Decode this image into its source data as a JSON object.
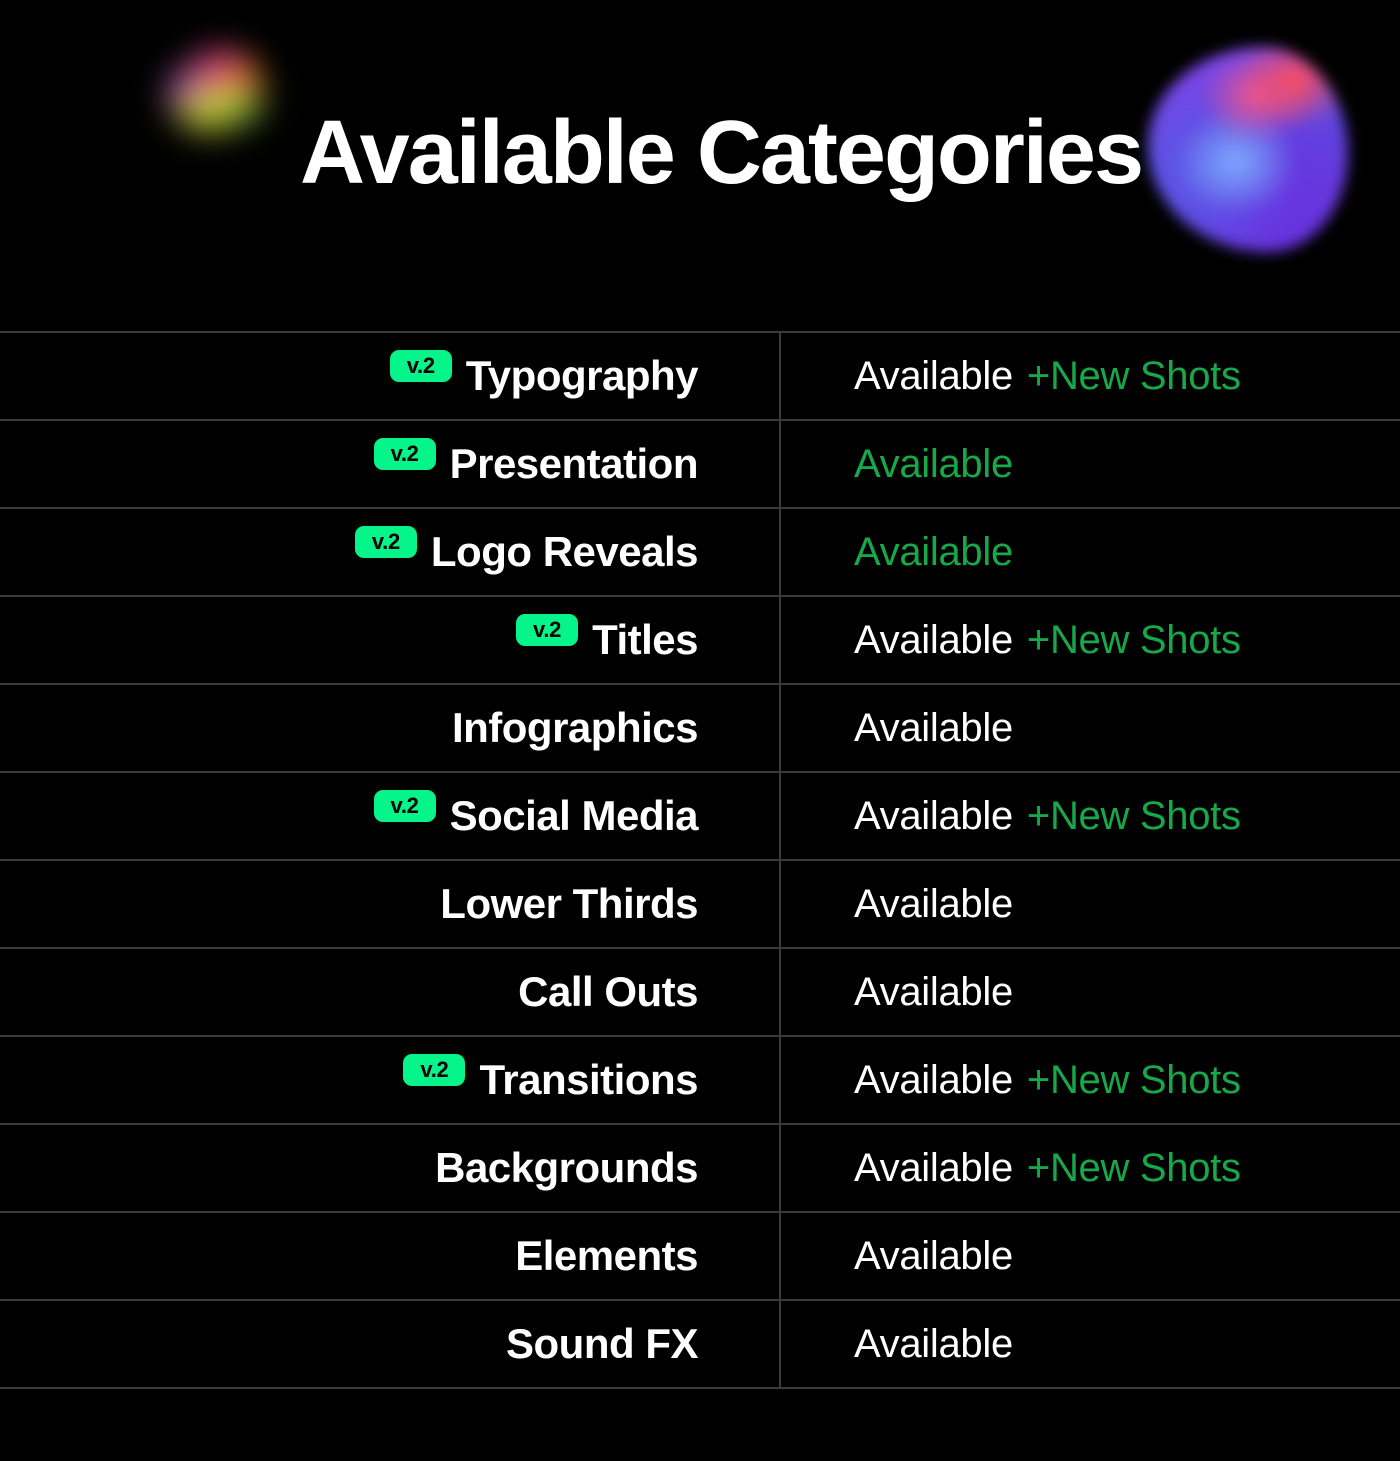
{
  "header": {
    "title": "Available Categories",
    "decorations": [
      {
        "name": "gradient-blob-small",
        "colors": [
          "#ff3fa4",
          "#d6e83a",
          "#9bd84a",
          "#b84ae0"
        ]
      },
      {
        "name": "gradient-blob-large",
        "colors": [
          "#ff4d5e",
          "#7fa9ff",
          "#5b5ce8",
          "#6a2ee0"
        ]
      }
    ]
  },
  "theme": {
    "background": "#000000",
    "text": "#ffffff",
    "grid_line": "#3a3a3a",
    "badge_bg": "#05F58A",
    "badge_text": "#000000",
    "accent_green": "#17A84A"
  },
  "table": {
    "badge_label": "v.2",
    "status_available": "Available",
    "status_new_shots": "+New Shots",
    "rows": [
      {
        "category": "Typography",
        "badge": "v.2",
        "status": "Available",
        "status_accent": false,
        "extra": "+New Shots"
      },
      {
        "category": "Presentation",
        "badge": "v.2",
        "status": "Available",
        "status_accent": true,
        "extra": ""
      },
      {
        "category": "Logo Reveals",
        "badge": "v.2",
        "status": "Available",
        "status_accent": true,
        "extra": ""
      },
      {
        "category": "Titles",
        "badge": "v.2",
        "status": "Available",
        "status_accent": false,
        "extra": "+New Shots"
      },
      {
        "category": "Infographics",
        "badge": "",
        "status": "Available",
        "status_accent": false,
        "extra": ""
      },
      {
        "category": "Social Media",
        "badge": "v.2",
        "status": "Available",
        "status_accent": false,
        "extra": "+New Shots"
      },
      {
        "category": "Lower Thirds",
        "badge": "",
        "status": "Available",
        "status_accent": false,
        "extra": ""
      },
      {
        "category": "Call Outs",
        "badge": "",
        "status": "Available",
        "status_accent": false,
        "extra": ""
      },
      {
        "category": "Transitions",
        "badge": "v.2",
        "status": "Available",
        "status_accent": false,
        "extra": "+New Shots"
      },
      {
        "category": "Backgrounds",
        "badge": "",
        "status": "Available",
        "status_accent": false,
        "extra": "+New Shots"
      },
      {
        "category": "Elements",
        "badge": "",
        "status": "Available",
        "status_accent": false,
        "extra": ""
      },
      {
        "category": "Sound FX",
        "badge": "",
        "status": "Available",
        "status_accent": false,
        "extra": ""
      }
    ]
  }
}
